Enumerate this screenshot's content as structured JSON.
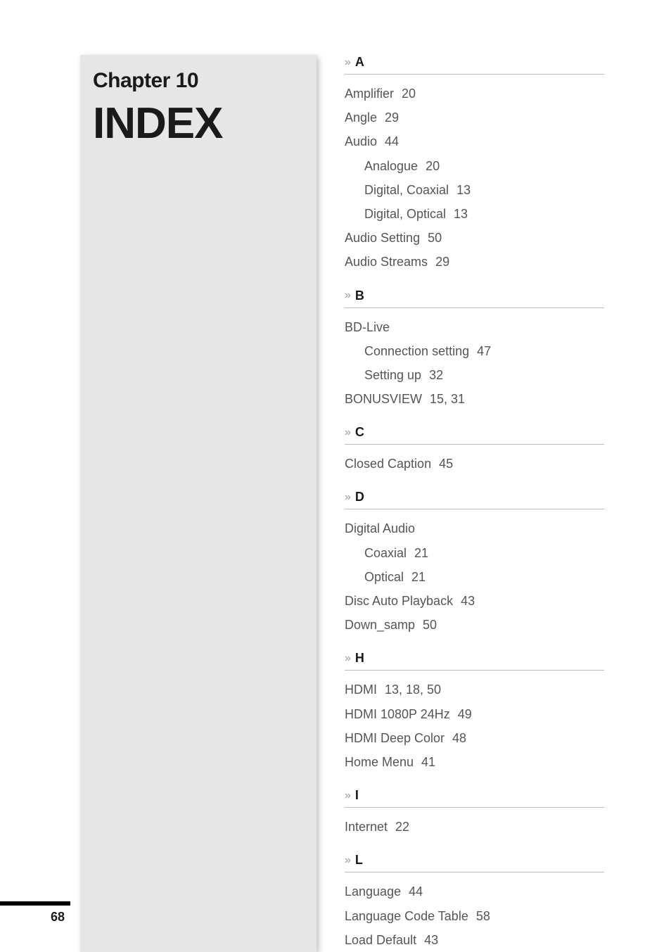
{
  "header": {
    "chapter": "Chapter 10",
    "title": "INDEX"
  },
  "sections": [
    {
      "letter": "A",
      "entries": [
        {
          "label": "Amplifier",
          "pages": "20",
          "sub": false
        },
        {
          "label": "Angle",
          "pages": "29",
          "sub": false
        },
        {
          "label": "Audio",
          "pages": "44",
          "sub": false
        },
        {
          "label": "Analogue",
          "pages": "20",
          "sub": true
        },
        {
          "label": "Digital, Coaxial",
          "pages": "13",
          "sub": true
        },
        {
          "label": "Digital, Optical",
          "pages": "13",
          "sub": true
        },
        {
          "label": "Audio Setting",
          "pages": "50",
          "sub": false
        },
        {
          "label": "Audio Streams",
          "pages": "29",
          "sub": false
        }
      ]
    },
    {
      "letter": "B",
      "entries": [
        {
          "label": "BD-Live",
          "pages": "",
          "sub": false
        },
        {
          "label": "Connection setting",
          "pages": "47",
          "sub": true
        },
        {
          "label": "Setting up",
          "pages": "32",
          "sub": true
        },
        {
          "label": "BONUSVIEW",
          "pages": "15, 31",
          "sub": false
        }
      ]
    },
    {
      "letter": "C",
      "entries": [
        {
          "label": "Closed Caption",
          "pages": "45",
          "sub": false
        }
      ]
    },
    {
      "letter": "D",
      "entries": [
        {
          "label": "Digital Audio",
          "pages": "",
          "sub": false
        },
        {
          "label": "Coaxial",
          "pages": "21",
          "sub": true
        },
        {
          "label": "Optical",
          "pages": "21",
          "sub": true
        },
        {
          "label": "Disc Auto Playback",
          "pages": "43",
          "sub": false
        },
        {
          "label": "Down_samp",
          "pages": "50",
          "sub": false
        }
      ]
    },
    {
      "letter": "H",
      "entries": [
        {
          "label": "HDMI",
          "pages": "13, 18, 50",
          "sub": false
        },
        {
          "label": "HDMI 1080P 24Hz",
          "pages": "49",
          "sub": false
        },
        {
          "label": "HDMI Deep Color",
          "pages": "48",
          "sub": false
        },
        {
          "label": "Home Menu",
          "pages": "41",
          "sub": false
        }
      ]
    },
    {
      "letter": "I",
      "entries": [
        {
          "label": "Internet",
          "pages": "22",
          "sub": false
        }
      ]
    },
    {
      "letter": "L",
      "entries": [
        {
          "label": "Language",
          "pages": "44",
          "sub": false
        },
        {
          "label": "Language Code Table",
          "pages": "58",
          "sub": false
        },
        {
          "label": "Load Default",
          "pages": "43",
          "sub": false
        }
      ]
    }
  ],
  "page_number": "68",
  "labels": {
    "chevron_glyph": "»"
  }
}
